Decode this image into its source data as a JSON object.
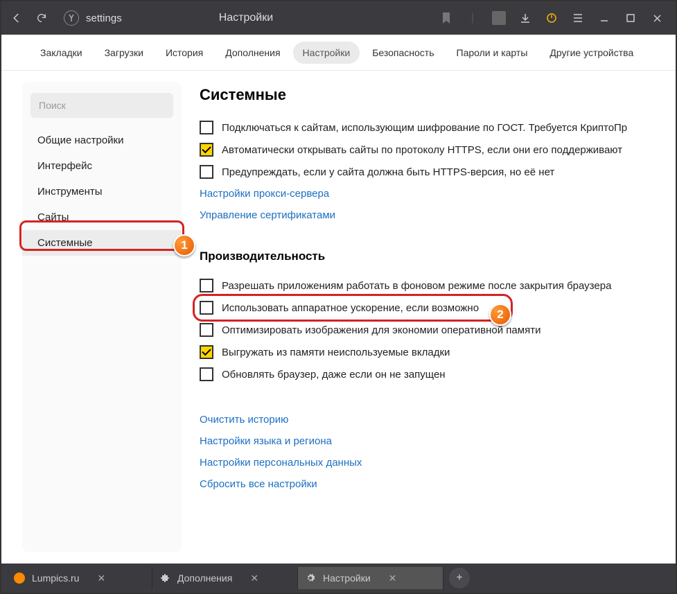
{
  "titlebar": {
    "address": "settings",
    "page_title": "Настройки"
  },
  "tabs": {
    "items": [
      "Закладки",
      "Загрузки",
      "История",
      "Дополнения",
      "Настройки",
      "Безопасность",
      "Пароли и карты",
      "Другие устройства"
    ],
    "active_index": 4
  },
  "sidebar": {
    "search_placeholder": "Поиск",
    "items": [
      "Общие настройки",
      "Интерфейс",
      "Инструменты",
      "Сайты",
      "Системные"
    ],
    "selected_index": 4,
    "callout_1": "1"
  },
  "settings": {
    "section_system_title": "Системные",
    "system_items": [
      {
        "label": "Подключаться к сайтам, использующим шифрование по ГОСТ. Требуется КриптоПр",
        "checked": false
      },
      {
        "label": "Автоматически открывать сайты по протоколу HTTPS, если они его поддерживают",
        "checked": true
      },
      {
        "label": "Предупреждать, если у сайта должна быть HTTPS-версия, но её нет",
        "checked": false
      }
    ],
    "proxy_link": "Настройки прокси-сервера",
    "cert_link": "Управление сертификатами",
    "section_perf_title": "Производительность",
    "perf_items": [
      {
        "label": "Разрешать приложениям работать в фоновом режиме после закрытия браузера",
        "checked": false
      },
      {
        "label": "Использовать аппаратное ускорение, если возможно",
        "checked": false,
        "highlighted": true
      },
      {
        "label": "Оптимизировать изображения для экономии оперативной памяти",
        "checked": false
      },
      {
        "label": "Выгружать из памяти неиспользуемые вкладки",
        "checked": true
      },
      {
        "label": "Обновлять браузер, даже если он не запущен",
        "checked": false
      }
    ],
    "callout_2": "2",
    "bottom_links": [
      "Очистить историю",
      "Настройки языка и региона",
      "Настройки персональных данных",
      "Сбросить все настройки"
    ]
  },
  "bottombar": {
    "tabs": [
      {
        "label": "Lumpics.ru",
        "icon_color": "#ff8a00"
      },
      {
        "label": "Дополнения",
        "icon": "puzzle"
      },
      {
        "label": "Настройки",
        "icon": "gear",
        "active": true
      }
    ]
  }
}
